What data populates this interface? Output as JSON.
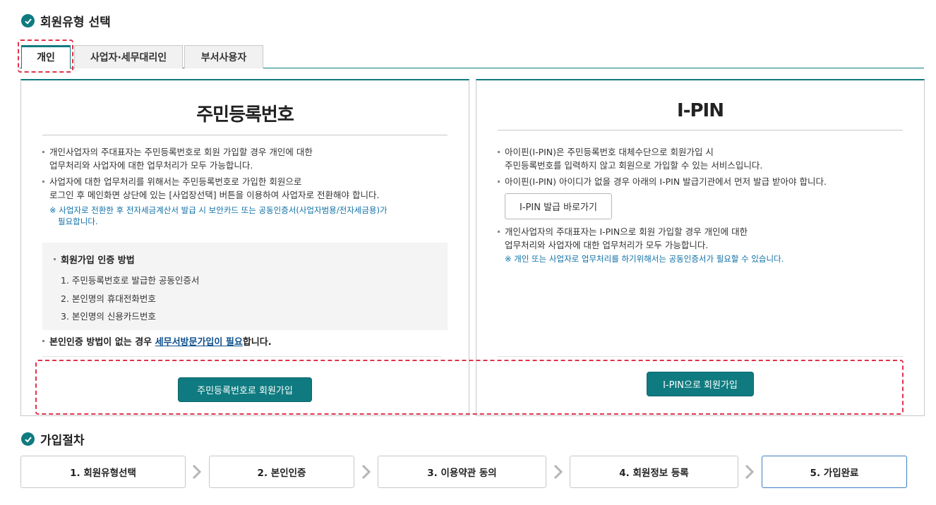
{
  "section1": {
    "title": "회원유형 선택"
  },
  "tabs": [
    {
      "label": "개인",
      "active": true
    },
    {
      "label": "사업자·세무대리인",
      "active": false
    },
    {
      "label": "부서사용자",
      "active": false
    }
  ],
  "left_panel": {
    "title": "주민등록번호",
    "desc1_line1": "개인사업자의 주대표자는 주민등록번호로 회원 가입할 경우 개인에 대한",
    "desc1_line2": "업무처리와 사업자에 대한 업무처리가 모두 가능합니다.",
    "desc2_line1": "사업자에 대한 업무처리를 위해서는 주민등록번호로 가입한 회원으로",
    "desc2_line2": "로그인 후 메인화면 상단에 있는 [사업장선택] 버튼을 이용하여 사업자로 전환해야 합니다.",
    "note_line1": "※ 사업자로 전환한 후 전자세금계산서 발급 시 보안카드 또는 공동인증서(사업자범용/전자세금용)가",
    "note_line2": "필요합니다.",
    "auth_title": "회원가입 인증 방법",
    "auth_items": [
      "1. 주민등록번호로 발급한 공동인증서",
      "2. 본인명의 휴대전화번호",
      "3. 본인명의 신용카드번호"
    ],
    "no_auth_prefix": "본인인증 방법이 없는 경우 ",
    "no_auth_link": "세무서방문가입이 필요",
    "no_auth_suffix": "합니다.",
    "button": "주민등록번호로 회원가입"
  },
  "right_panel": {
    "title": "I-PIN",
    "desc1_line1": "아이핀(I-PIN)은 주민등록번호 대체수단으로 회원가입 시",
    "desc1_line2": "주민등록번호를 입력하지 않고 회원으로 가입할 수 있는 서비스입니다.",
    "desc2": "아이핀(I-PIN) 아이디가 없을 경우 아래의 I-PIN 발급기관에서 먼저 발급 받아야 합니다.",
    "issue_button": "I-PIN 발급 바로가기",
    "desc3_line1": "개인사업자의 주대표자는 I-PIN으로 회원 가입할 경우 개인에 대한",
    "desc3_line2": "업무처리와 사업자에 대한 업무처리가 모두 가능합니다.",
    "note": "※ 개인 또는 사업자로 업무처리를 하기위해서는 공동인증서가 필요할 수 있습니다.",
    "button": "I-PIN으로 회원가입"
  },
  "section2": {
    "title": "가입절차"
  },
  "steps": [
    {
      "label": "1. 회원유형선택"
    },
    {
      "label": "2. 본인인증"
    },
    {
      "label": "3. 이용약관 동의"
    },
    {
      "label": "4. 회원정보 등록"
    },
    {
      "label": "5. 가입완료"
    }
  ],
  "colors": {
    "accent": "#0f7b80",
    "highlight": "#e0334b",
    "link": "#0d4f8c",
    "note": "#0d6fa5"
  }
}
